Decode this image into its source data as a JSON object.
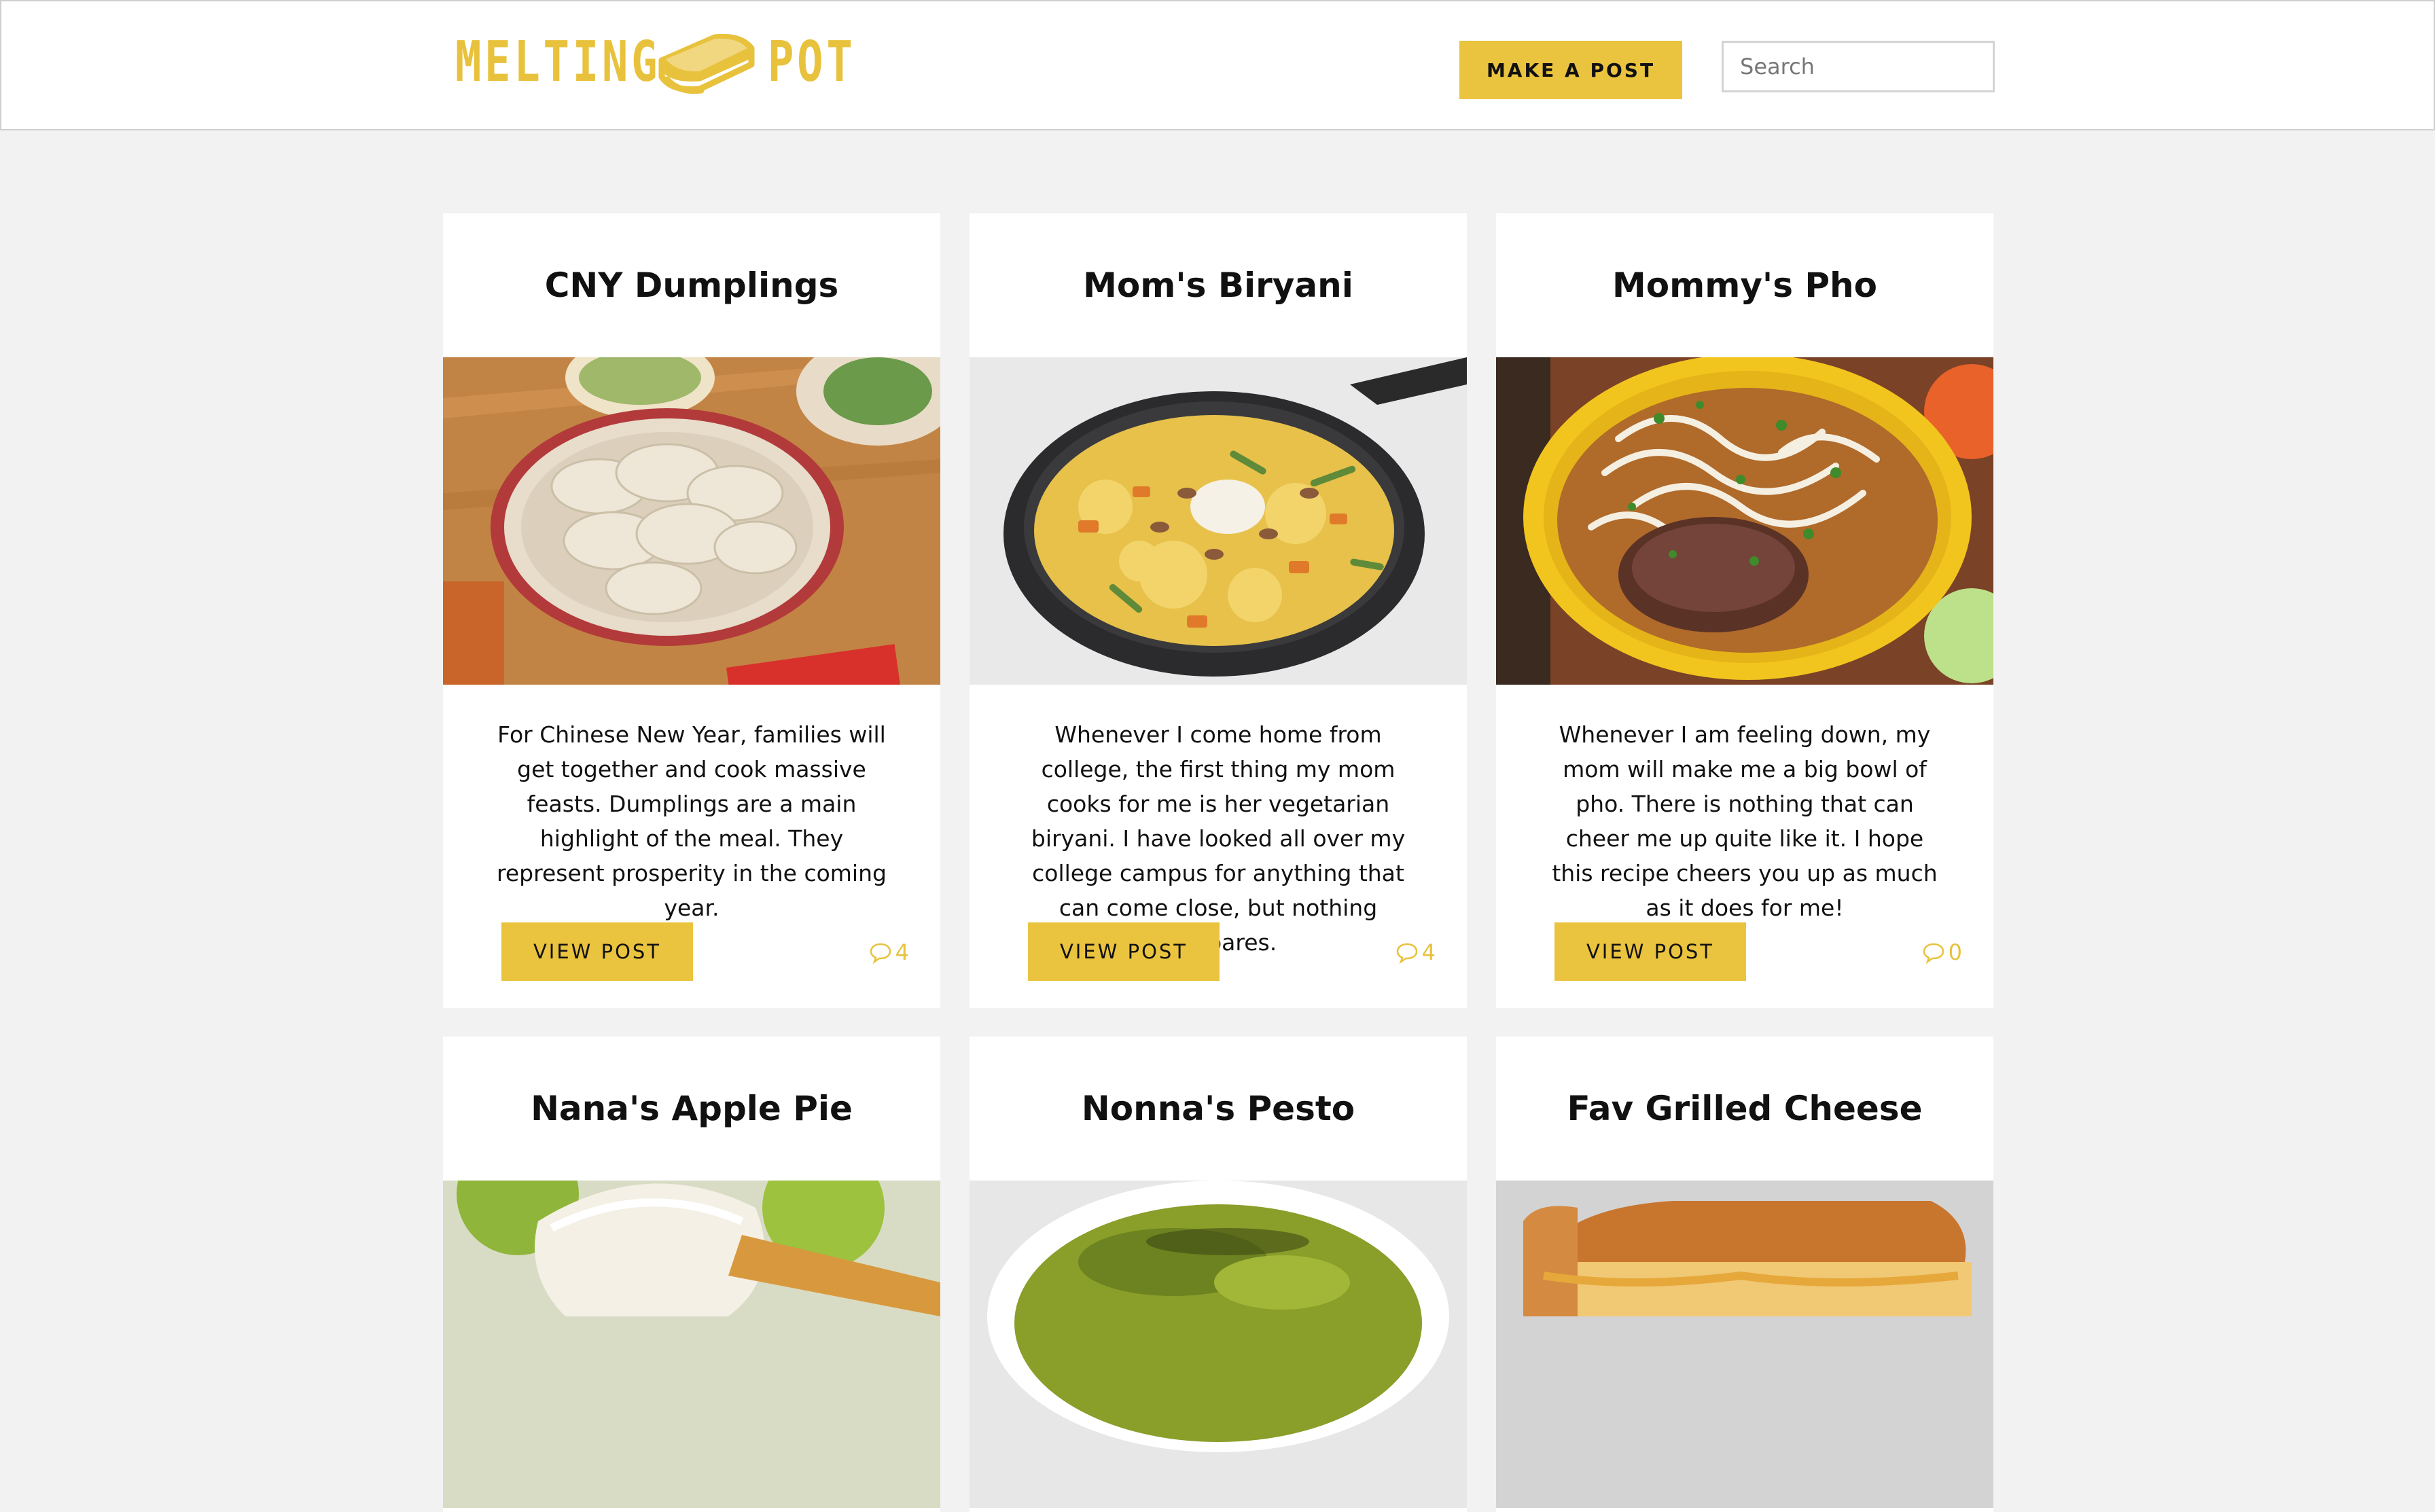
{
  "brand": {
    "word1": "MELTING",
    "word2": "POT",
    "accent_color": "#eac43f",
    "logo_icon": "sandwich-icon"
  },
  "header": {
    "make_post_label": "MAKE A POST",
    "search_placeholder": "Search",
    "search_icon": "search-icon"
  },
  "cards": [
    {
      "title": "CNY Dumplings",
      "image": "dumplings-photo",
      "description": "For Chinese New Year, families will get together and cook massive feasts. Dumplings are a main highlight of the meal. They represent prosperity in the coming year.",
      "button_label": "VIEW POST",
      "comment_count": "4"
    },
    {
      "title": "Mom's Biryani",
      "image": "biryani-photo",
      "description": "Whenever I come home from college, the first thing my mom cooks for me is her vegetarian biryani. I have looked all over my college campus for anything that can come close, but nothing compares.",
      "button_label": "VIEW POST",
      "comment_count": "4"
    },
    {
      "title": "Mommy's Pho",
      "image": "pho-photo",
      "description": "Whenever I am feeling down, my mom will make me a big bowl of pho. There is nothing that can cheer me up quite like it. I hope this recipe cheers you up as much as it does for me!",
      "button_label": "VIEW POST",
      "comment_count": "0"
    },
    {
      "title": "Nana's Apple Pie",
      "image": "apple-pie-photo"
    },
    {
      "title": "Nonna's Pesto",
      "image": "pesto-photo"
    },
    {
      "title": "Fav Grilled Cheese",
      "image": "grilled-cheese-photo"
    }
  ]
}
